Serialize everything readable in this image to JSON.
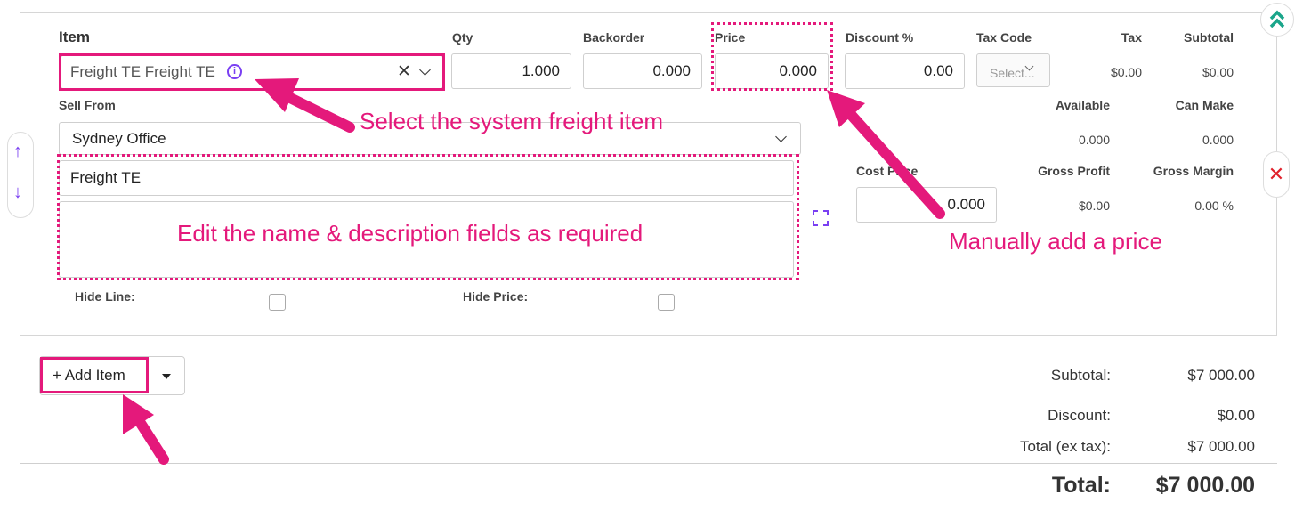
{
  "line_item": {
    "headers": {
      "item": "Item",
      "qty": "Qty",
      "backorder": "Backorder",
      "price": "Price",
      "discount": "Discount %",
      "tax_code": "Tax Code",
      "tax": "Tax",
      "subtotal": "Subtotal",
      "sell_from": "Sell From",
      "available": "Available",
      "can_make": "Can Make",
      "cost_price": "Cost Price",
      "gross_profit": "Gross Profit",
      "gross_margin": "Gross Margin",
      "hide_line": "Hide Line:",
      "hide_price": "Hide Price:"
    },
    "item_value": "Freight TE Freight TE",
    "info_icon_glyph": "i",
    "clear_glyph": "✕",
    "qty": "1.000",
    "backorder": "0.000",
    "price": "0.000",
    "discount": "0.00",
    "tax_code_placeholder": "Select...",
    "tax": "$0.00",
    "subtotal": "$0.00",
    "sell_from": "Sydney Office",
    "available": "0.000",
    "can_make": "0.000",
    "cost_price": "0.000",
    "gross_profit": "$0.00",
    "gross_margin": "0.00 %",
    "name": "Freight TE",
    "description": "",
    "hide_line": false,
    "hide_price": false
  },
  "controls": {
    "move_up_glyph": "↑",
    "move_down_glyph": "↓",
    "delete_glyph": "✕",
    "collapse_icon": "double-chevron-up-icon",
    "expand_icon": "expand-corners-icon",
    "add_item_label": "+ Add Item"
  },
  "totals": {
    "subtotal_label": "Subtotal:",
    "subtotal_value": "$7 000.00",
    "discount_label": "Discount:",
    "discount_value": "$0.00",
    "total_ex_tax_label": "Total (ex tax):",
    "total_ex_tax_value": "$7 000.00",
    "total_label": "Total:",
    "total_value": "$7 000.00"
  },
  "annotations": {
    "select_item": "Select the system freight item",
    "edit_fields": "Edit the name & description fields as required",
    "add_price": "Manually add a price"
  },
  "colors": {
    "annotation": "#e4197b",
    "accent_purple": "#7a3ff2",
    "collapse_green": "#1aa58a",
    "delete_red": "#e0202a"
  }
}
